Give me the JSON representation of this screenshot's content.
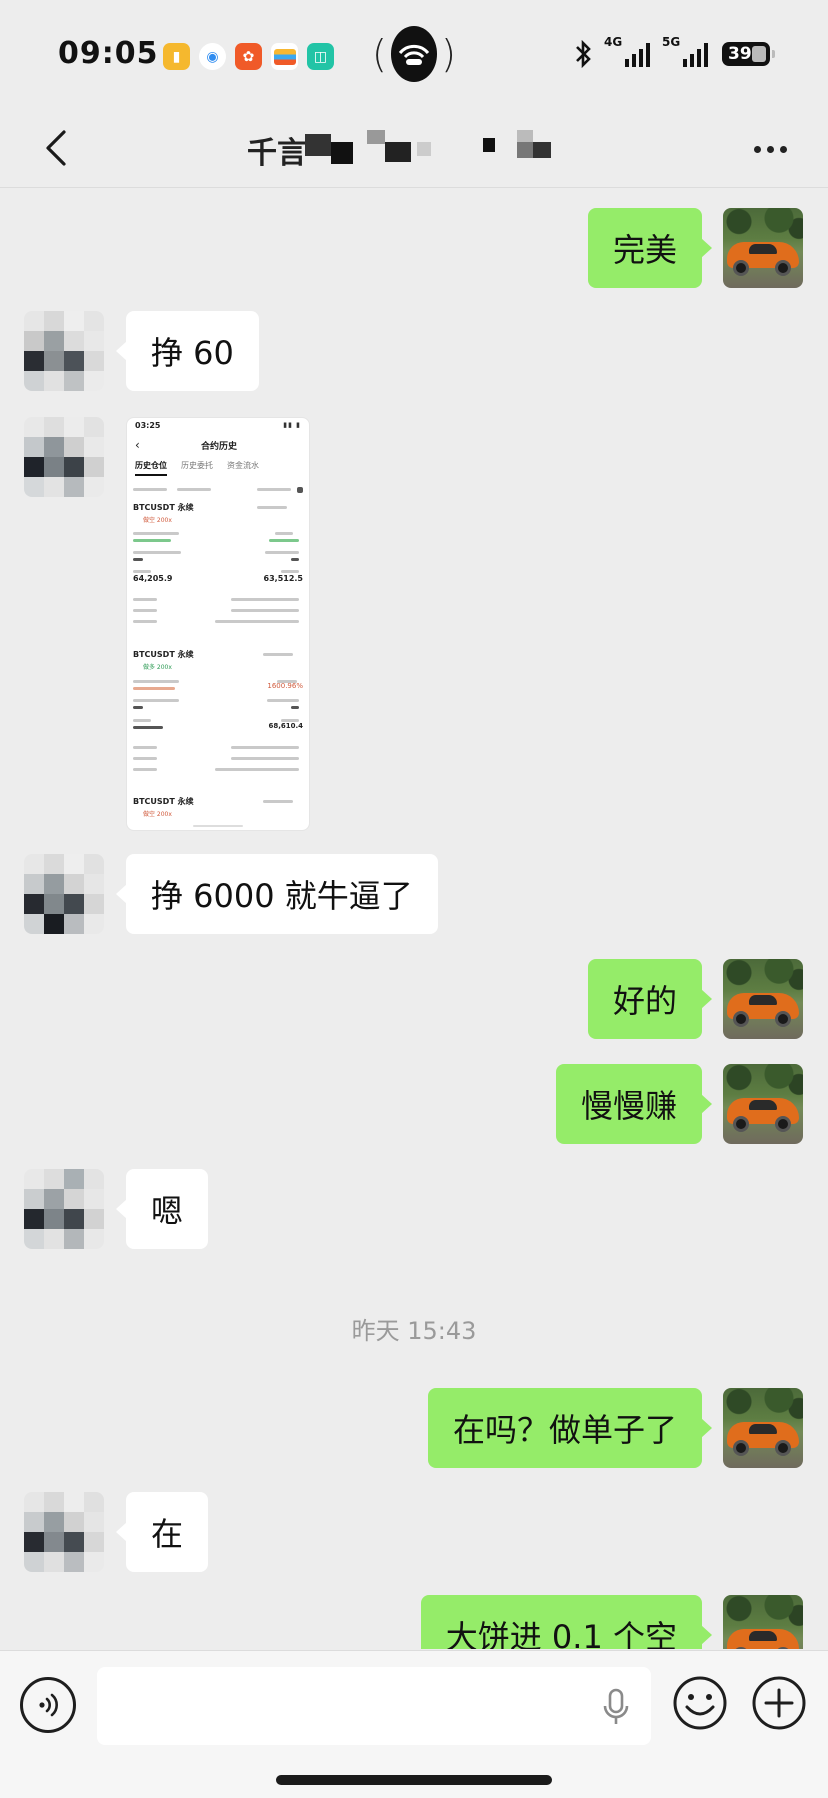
{
  "status_bar": {
    "time": "09:05",
    "signal_1_label": "4G",
    "signal_2_label": "5G",
    "battery": "39",
    "app_icons": [
      "notes-app-icon",
      "browser-app-icon",
      "video-app-icon",
      "wallet-app-icon",
      "mi-home-app-icon"
    ]
  },
  "nav": {
    "title": "千言",
    "back_icon": "chevron-left-icon",
    "more_icon": "more-dots-icon"
  },
  "messages": [
    {
      "side": "right",
      "type": "text",
      "text": "完美"
    },
    {
      "side": "left",
      "type": "text",
      "text": "挣 60"
    },
    {
      "side": "left",
      "type": "image",
      "screenshot": {
        "time": "03:25",
        "title": "合约历史",
        "tabs": [
          "历史仓位",
          "历史委托",
          "资金流水"
        ],
        "positions": [
          {
            "symbol": "BTCUSDT 永续",
            "side_label": "做空 200x",
            "value_1": "64,205.9",
            "value_2": "63,512.5"
          },
          {
            "symbol": "BTCUSDT 永续",
            "side_label": "做多 200x",
            "value_1": "1600.96%",
            "value_2": "68,610.4"
          },
          {
            "symbol": "BTCUSDT 永续",
            "side_label": "做空 200x"
          }
        ]
      }
    },
    {
      "side": "left",
      "type": "text",
      "text": "挣 6000 就牛逼了"
    },
    {
      "side": "right",
      "type": "text",
      "text": "好的"
    },
    {
      "side": "right",
      "type": "text",
      "text": "慢慢赚"
    },
    {
      "side": "left",
      "type": "text",
      "text": "嗯"
    },
    {
      "type": "timestamp",
      "text": "昨天 15:43"
    },
    {
      "side": "right",
      "type": "text",
      "text": "在吗？做单子了"
    },
    {
      "side": "left",
      "type": "text",
      "text": "在"
    },
    {
      "side": "right",
      "type": "text",
      "text": "大饼进 0.1 个空"
    }
  ],
  "input_bar": {
    "placeholder": "",
    "voice_icon": "voice-mode-icon",
    "mic_icon": "microphone-icon",
    "emoji_icon": "emoji-icon",
    "plus_icon": "plus-icon"
  },
  "colors": {
    "background": "#ededed",
    "bubble_self": "#95ec69",
    "bubble_other": "#ffffff",
    "timestamp": "#9a9a9a"
  }
}
